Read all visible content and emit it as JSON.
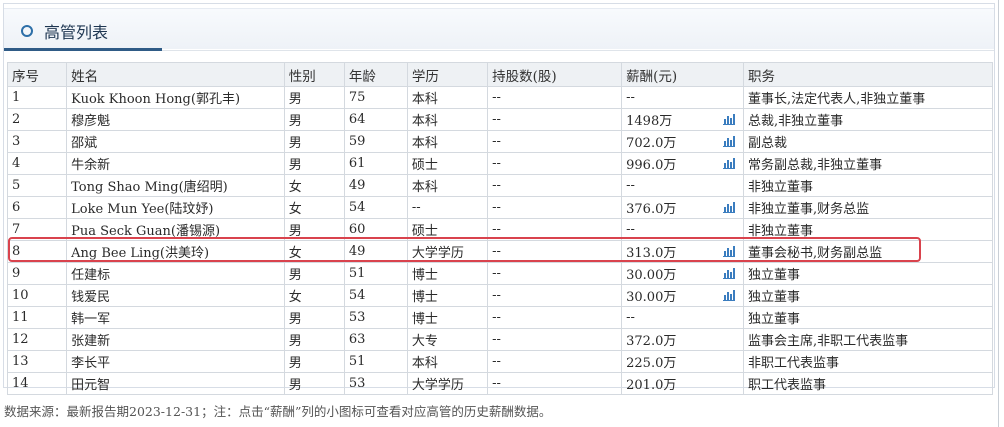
{
  "header": {
    "title": "高管列表"
  },
  "table": {
    "columns": [
      "序号",
      "姓名",
      "性别",
      "年龄",
      "学历",
      "持股数(股)",
      "薪酬(元)",
      "职务"
    ],
    "rows": [
      {
        "no": "1",
        "name": "Kuok Khoon Hong(郭孔丰)",
        "gender": "男",
        "age": "75",
        "edu": "本科",
        "shares": "--",
        "salary": "--",
        "chart": false,
        "position": "董事长,法定代表人,非独立董事"
      },
      {
        "no": "2",
        "name": "穆彦魁",
        "gender": "男",
        "age": "64",
        "edu": "本科",
        "shares": "--",
        "salary": "1498万",
        "chart": true,
        "position": "总裁,非独立董事"
      },
      {
        "no": "3",
        "name": "邵斌",
        "gender": "男",
        "age": "59",
        "edu": "本科",
        "shares": "--",
        "salary": "702.0万",
        "chart": true,
        "position": "副总裁"
      },
      {
        "no": "4",
        "name": "牛余新",
        "gender": "男",
        "age": "61",
        "edu": "硕士",
        "shares": "--",
        "salary": "996.0万",
        "chart": true,
        "position": "常务副总裁,非独立董事"
      },
      {
        "no": "5",
        "name": "Tong Shao Ming(唐绍明)",
        "gender": "女",
        "age": "49",
        "edu": "本科",
        "shares": "--",
        "salary": "--",
        "chart": false,
        "position": "非独立董事"
      },
      {
        "no": "6",
        "name": "Loke Mun Yee(陆玟妤)",
        "gender": "女",
        "age": "54",
        "edu": "--",
        "shares": "--",
        "salary": "376.0万",
        "chart": true,
        "position": "非独立董事,财务总监"
      },
      {
        "no": "7",
        "name": "Pua Seck Guan(潘锡源)",
        "gender": "男",
        "age": "60",
        "edu": "硕士",
        "shares": "--",
        "salary": "--",
        "chart": false,
        "position": "非独立董事"
      },
      {
        "no": "8",
        "name": "Ang Bee Ling(洪美玲)",
        "gender": "女",
        "age": "49",
        "edu": "大学学历",
        "shares": "--",
        "salary": "313.0万",
        "chart": true,
        "position": "董事会秘书,财务副总监"
      },
      {
        "no": "9",
        "name": "任建标",
        "gender": "男",
        "age": "51",
        "edu": "博士",
        "shares": "--",
        "salary": "30.00万",
        "chart": true,
        "position": "独立董事"
      },
      {
        "no": "10",
        "name": "钱爱民",
        "gender": "女",
        "age": "54",
        "edu": "博士",
        "shares": "--",
        "salary": "30.00万",
        "chart": true,
        "position": "独立董事"
      },
      {
        "no": "11",
        "name": "韩一军",
        "gender": "男",
        "age": "53",
        "edu": "博士",
        "shares": "--",
        "salary": "--",
        "chart": false,
        "position": "独立董事"
      },
      {
        "no": "12",
        "name": "张建新",
        "gender": "男",
        "age": "63",
        "edu": "大专",
        "shares": "--",
        "salary": "372.0万",
        "chart": false,
        "position": "监事会主席,非职工代表监事"
      },
      {
        "no": "13",
        "name": "李长平",
        "gender": "男",
        "age": "51",
        "edu": "本科",
        "shares": "--",
        "salary": "225.0万",
        "chart": false,
        "position": "非职工代表监事"
      },
      {
        "no": "14",
        "name": "田元智",
        "gender": "男",
        "age": "53",
        "edu": "大学学历",
        "shares": "--",
        "salary": "201.0万",
        "chart": false,
        "position": "职工代表监事"
      }
    ]
  },
  "footnote": "数据来源：最新报告期2023-12-31；注：点击“薪酬”列的小图标可查看对应高管的历史薪酬数据。",
  "colors": {
    "accent": "#2f5b86",
    "highlight": "#d9434d",
    "icon": "#3b7dbf"
  },
  "icons": {
    "salary_chart": "bar-chart-icon",
    "header": "circle-bullet-icon"
  }
}
